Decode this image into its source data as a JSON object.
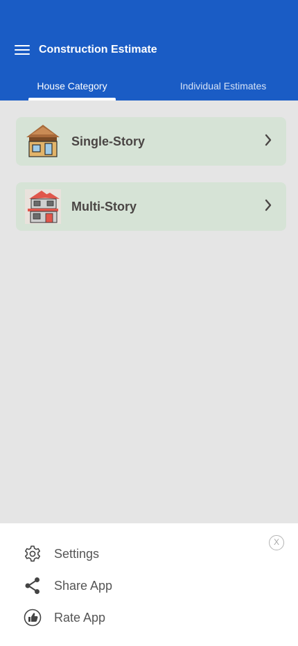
{
  "app_bar": {
    "title": "Construction Estimate",
    "background_color": "#1a5cc5",
    "menu_icon": "hamburger-menu-icon"
  },
  "tabs": [
    {
      "label": "House Category",
      "selected": true
    },
    {
      "label": "Individual Estimates",
      "selected": false
    }
  ],
  "categories": [
    {
      "label": "Single-Story",
      "icon": "single-story-house-icon",
      "chevron": "chevron-right-icon"
    },
    {
      "label": "Multi-Story",
      "icon": "multi-story-house-icon",
      "chevron": "chevron-right-icon"
    }
  ],
  "drawer": {
    "close_label": "X",
    "items": [
      {
        "label": "Settings",
        "icon": "gear-icon"
      },
      {
        "label": "Share App",
        "icon": "share-icon"
      },
      {
        "label": "Rate App",
        "icon": "thumbs-up-icon"
      }
    ]
  },
  "colors": {
    "card_background": "#d6e3d6",
    "page_background": "#e5e5e5",
    "accent": "#1a5cc5"
  }
}
